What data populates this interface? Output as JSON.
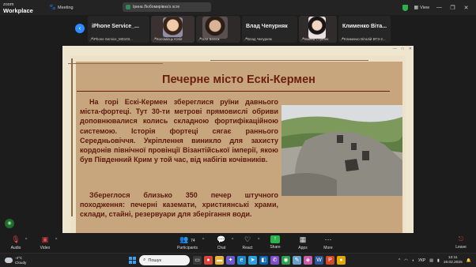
{
  "app": {
    "brand_top": "zoom",
    "brand_bottom": "Workplace",
    "meeting_label": "Meeting"
  },
  "share_notice": "Ірина Любомирівна's scre",
  "topbar_right": {
    "view_label": "View"
  },
  "gallery": {
    "tiles": [
      {
        "big_name": "iPhone Service_...",
        "caption": "iPhone Service_MD103..."
      },
      {
        "caption": "Коломієць Юлія"
      },
      {
        "caption": "Іхля Белюк"
      },
      {
        "big_name": "Влад Чепурняк",
        "caption": "Влад Чепурняк"
      },
      {
        "caption": "Іванна Стрілен"
      },
      {
        "big_name": "Клименко Віта...",
        "caption": "Клименко Віталій ВТЭ-2..."
      }
    ]
  },
  "slide": {
    "title": "Печерне місто Ескі-Кермен",
    "paragraph1": "На горі Ескі-Кермен збереглися руїни давнього міста-фортеці. Тут 30-ти метрові прямовислі обриви доповнювалися колись складною фортифікаційною системою. Історія фортеці сягає раннього Середньовіччя. Укріплення виникло для захисту кордонів північної провінції Візантійської імперії, якою був Південний Крим у той час, від набігів кочівників.",
    "paragraph2": "Збереглося близько 350 печер штучного походження: печерні каземати, християнські храми, склади, стайні, резервуари для зберігання води."
  },
  "controls": {
    "audio": "Audio",
    "video": "Video",
    "participants": "Participants",
    "participants_count": "74",
    "chat": "Chat",
    "react": "React",
    "share": "Share",
    "apps": "Apps",
    "more": "More",
    "leave": "Leave"
  },
  "taskbar": {
    "temperature": "-4°C",
    "condition": "Cloudy",
    "search_placeholder": "Пошук",
    "language": "УКР",
    "time": "12:11",
    "date": "19.02.2025"
  },
  "colors": {
    "accent": "#2d8cff",
    "share_green": "#2db24a",
    "leave_red": "#e23c3c",
    "slide_brown": "#c7a67d",
    "title_red": "#6b1f10"
  }
}
